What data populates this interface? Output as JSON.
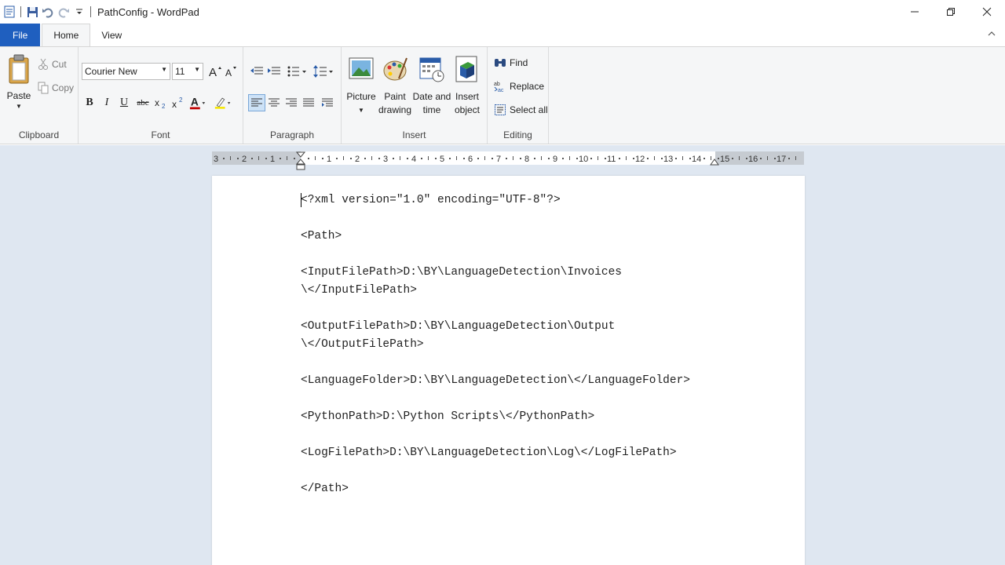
{
  "window": {
    "title": "PathConfig - WordPad"
  },
  "tabs": [
    {
      "label": "File"
    },
    {
      "label": "Home"
    },
    {
      "label": "View"
    }
  ],
  "clipboard": {
    "paste": "Paste",
    "cut": "Cut",
    "copy": "Copy",
    "group_label": "Clipboard"
  },
  "font": {
    "family": "Courier New",
    "size": "11",
    "group_label": "Font"
  },
  "paragraph": {
    "group_label": "Paragraph"
  },
  "insert": {
    "picture": "Picture",
    "paint": "Paint",
    "paint2": "drawing",
    "datetime": "Date and",
    "datetime2": "time",
    "object": "Insert",
    "object2": "object",
    "group_label": "Insert"
  },
  "editing": {
    "find": "Find",
    "replace": "Replace",
    "select_all": "Select all",
    "group_label": "Editing"
  },
  "ruler": {
    "ticks": [
      "3",
      "2",
      "1",
      "1",
      "2",
      "3",
      "4",
      "5",
      "6",
      "7",
      "8",
      "9",
      "10",
      "11",
      "12",
      "13",
      "14",
      "15",
      "16",
      "17"
    ]
  },
  "document": {
    "lines": [
      "<?xml version=\"1.0\" encoding=\"UTF-8\"?>",
      "",
      "<Path>",
      "",
      "<InputFilePath>D:\\BY\\LanguageDetection\\Invoices",
      "\\</InputFilePath>",
      "",
      "<OutputFilePath>D:\\BY\\LanguageDetection\\Output",
      "\\</OutputFilePath>",
      "",
      "<LanguageFolder>D:\\BY\\LanguageDetection\\</LanguageFolder>",
      "",
      "<PythonPath>D:\\Python Scripts\\</PythonPath>",
      "",
      "<LogFilePath>D:\\BY\\LanguageDetection\\Log\\</LogFilePath>",
      "",
      "</Path>"
    ]
  },
  "colors": {
    "file_tab": "#1f5fbf",
    "ribbon": "#f5f6f7",
    "workspace": "#dfe7f1"
  }
}
